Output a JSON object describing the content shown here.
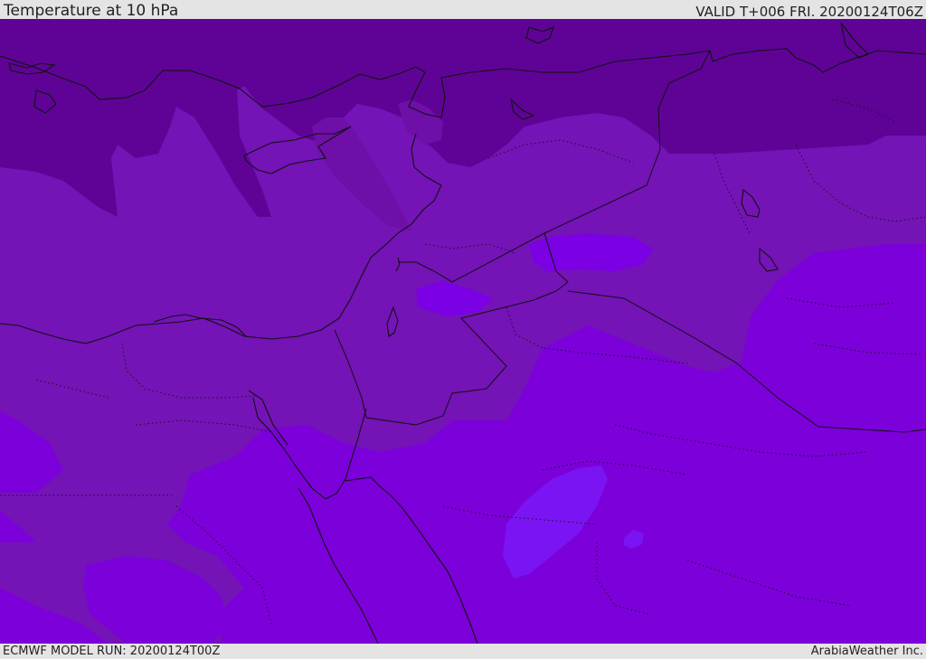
{
  "header": {
    "title": "Temperature at 10 hPa",
    "valid": "VALID T+006 FRI. 20200124T06Z"
  },
  "footer": {
    "model_run": "ECMWF MODEL RUN: 20200124T00Z",
    "credit": "ArabiaWeather Inc."
  },
  "colors": {
    "coldest": "#5f0396",
    "cold": "#6e0fa8",
    "mid": "#7413b6",
    "warm": "#7c00d9",
    "warmest": "#7a14f2",
    "coastline": "#111111"
  }
}
